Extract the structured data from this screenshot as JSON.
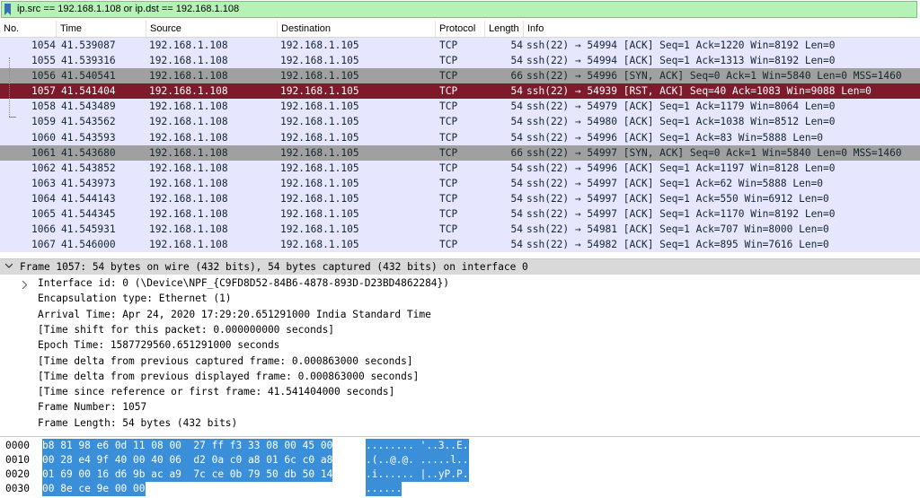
{
  "filter": {
    "value": "ip.src == 192.168.1.108 or ip.dst == 192.168.1.108"
  },
  "columns": [
    "No.",
    "Time",
    "Source",
    "Destination",
    "Protocol",
    "Length",
    "Info"
  ],
  "packets": [
    {
      "no": "1054",
      "time": "41.539087",
      "src": "192.168.1.108",
      "dst": "192.168.1.105",
      "proto": "TCP",
      "len": "54",
      "info": "ssh(22) → 54994 [ACK] Seq=1 Ack=1220 Win=8192 Len=0",
      "style": "tcp"
    },
    {
      "no": "1055",
      "time": "41.539316",
      "src": "192.168.1.108",
      "dst": "192.168.1.105",
      "proto": "TCP",
      "len": "54",
      "info": "ssh(22) → 54994 [ACK] Seq=1 Ack=1313 Win=8192 Len=0",
      "style": "tcp"
    },
    {
      "no": "1056",
      "time": "41.540541",
      "src": "192.168.1.108",
      "dst": "192.168.1.105",
      "proto": "TCP",
      "len": "66",
      "info": "ssh(22) → 54996 [SYN, ACK] Seq=0 Ack=1 Win=5840 Len=0 MSS=1460",
      "style": "syn"
    },
    {
      "no": "1057",
      "time": "41.541404",
      "src": "192.168.1.108",
      "dst": "192.168.1.105",
      "proto": "TCP",
      "len": "54",
      "info": "ssh(22) → 54939 [RST, ACK] Seq=40 Ack=1083 Win=9088 Len=0",
      "style": "sel"
    },
    {
      "no": "1058",
      "time": "41.543489",
      "src": "192.168.1.108",
      "dst": "192.168.1.105",
      "proto": "TCP",
      "len": "54",
      "info": "ssh(22) → 54979 [ACK] Seq=1 Ack=1179 Win=8064 Len=0",
      "style": "tcp"
    },
    {
      "no": "1059",
      "time": "41.543562",
      "src": "192.168.1.108",
      "dst": "192.168.1.105",
      "proto": "TCP",
      "len": "54",
      "info": "ssh(22) → 54980 [ACK] Seq=1 Ack=1038 Win=8512 Len=0",
      "style": "tcp"
    },
    {
      "no": "1060",
      "time": "41.543593",
      "src": "192.168.1.108",
      "dst": "192.168.1.105",
      "proto": "TCP",
      "len": "54",
      "info": "ssh(22) → 54996 [ACK] Seq=1 Ack=83 Win=5888 Len=0",
      "style": "tcp"
    },
    {
      "no": "1061",
      "time": "41.543680",
      "src": "192.168.1.108",
      "dst": "192.168.1.105",
      "proto": "TCP",
      "len": "66",
      "info": "ssh(22) → 54997 [SYN, ACK] Seq=0 Ack=1 Win=5840 Len=0 MSS=1460",
      "style": "syn"
    },
    {
      "no": "1062",
      "time": "41.543852",
      "src": "192.168.1.108",
      "dst": "192.168.1.105",
      "proto": "TCP",
      "len": "54",
      "info": "ssh(22) → 54996 [ACK] Seq=1 Ack=1197 Win=8128 Len=0",
      "style": "tcp"
    },
    {
      "no": "1063",
      "time": "41.543973",
      "src": "192.168.1.108",
      "dst": "192.168.1.105",
      "proto": "TCP",
      "len": "54",
      "info": "ssh(22) → 54997 [ACK] Seq=1 Ack=62 Win=5888 Len=0",
      "style": "tcp"
    },
    {
      "no": "1064",
      "time": "41.544143",
      "src": "192.168.1.108",
      "dst": "192.168.1.105",
      "proto": "TCP",
      "len": "54",
      "info": "ssh(22) → 54997 [ACK] Seq=1 Ack=550 Win=6912 Len=0",
      "style": "tcp"
    },
    {
      "no": "1065",
      "time": "41.544345",
      "src": "192.168.1.108",
      "dst": "192.168.1.105",
      "proto": "TCP",
      "len": "54",
      "info": "ssh(22) → 54997 [ACK] Seq=1 Ack=1170 Win=8192 Len=0",
      "style": "tcp"
    },
    {
      "no": "1066",
      "time": "41.545931",
      "src": "192.168.1.108",
      "dst": "192.168.1.105",
      "proto": "TCP",
      "len": "54",
      "info": "ssh(22) → 54981 [ACK] Seq=1 Ack=707 Win=8000 Len=0",
      "style": "tcp"
    },
    {
      "no": "1067",
      "time": "41.546000",
      "src": "192.168.1.108",
      "dst": "192.168.1.105",
      "proto": "TCP",
      "len": "54",
      "info": "ssh(22) → 54982 [ACK] Seq=1 Ack=895 Win=7616 Len=0",
      "style": "tcp"
    }
  ],
  "details": {
    "frame_summary": "Frame 1057: 54 bytes on wire (432 bits), 54 bytes captured (432 bits) on interface 0",
    "lines": [
      "Interface id: 0 (\\Device\\NPF_{C9FD8D52-84B6-4878-893D-D23BD4862284})",
      "Encapsulation type: Ethernet (1)",
      "Arrival Time: Apr 24, 2020 17:29:20.651291000 India Standard Time",
      "[Time shift for this packet: 0.000000000 seconds]",
      "Epoch Time: 1587729560.651291000 seconds",
      "[Time delta from previous captured frame: 0.000863000 seconds]",
      "[Time delta from previous displayed frame: 0.000863000 seconds]",
      "[Time since reference or first frame: 41.541404000 seconds]",
      "Frame Number: 1057",
      "Frame Length: 54 bytes (432 bits)"
    ]
  },
  "bytes": [
    {
      "offset": "0000",
      "hex": "b8 81 98 e6 0d 11 08 00  27 ff f3 33 08 00 45 00",
      "ascii": "........ '..3..E."
    },
    {
      "offset": "0010",
      "hex": "00 28 e4 9f 40 00 40 06  d2 0a c0 a8 01 6c c0 a8",
      "ascii": ".(..@.@. .....l.."
    },
    {
      "offset": "0020",
      "hex": "01 69 00 16 d6 9b ac a9  7c ce 0b 79 50 db 50 14",
      "ascii": ".i...... |..yP.P."
    },
    {
      "offset": "0030",
      "hex": "00 8e ce 9e 00 00",
      "ascii": "......"
    }
  ],
  "colors": {
    "filter_bg": "#b6f2b6",
    "tcp_row": "#e7e6ff",
    "syn_row": "#a0a0a0",
    "selected_row": "#7e1a2a",
    "bytes_highlight": "#3b8fd9"
  }
}
